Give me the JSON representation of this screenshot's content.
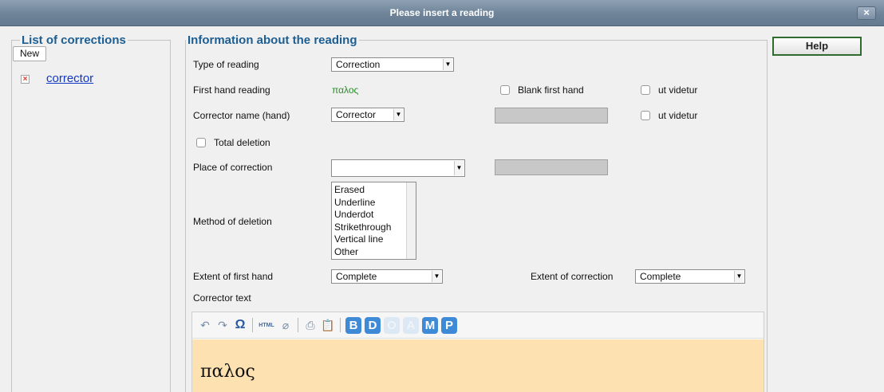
{
  "dialog": {
    "title": "Please insert a reading",
    "close_symbol": "×"
  },
  "corrections": {
    "legend": "List of corrections",
    "new_label": "New",
    "items": [
      {
        "label": "corrector",
        "delete_symbol": "×"
      }
    ]
  },
  "reading": {
    "legend": "Information about the reading",
    "type_label": "Type of reading",
    "type_value": "Correction",
    "first_hand_label": "First hand reading",
    "first_hand_value": "παλος",
    "blank_first_hand_label": "Blank first hand",
    "ut_videtur_label": "ut videtur",
    "corrector_name_label": "Corrector name (hand)",
    "corrector_name_value": "Corrector",
    "total_deletion_label": "Total deletion",
    "place_label": "Place of correction",
    "place_value": "",
    "method_label": "Method of deletion",
    "method_options": [
      "Erased",
      "Underline",
      "Underdot",
      "Strikethrough",
      "Vertical line",
      "Other"
    ],
    "extent_first_label": "Extent of first hand",
    "extent_first_value": "Complete",
    "extent_correction_label": "Extent of correction",
    "extent_correction_value": "Complete",
    "corrector_text_label": "Corrector text",
    "corrector_text_value": "παλος"
  },
  "help": {
    "label": "Help"
  },
  "editor_toolbar": {
    "undo_glyph": "↶",
    "redo_glyph": "↷",
    "omega_glyph": "Ω",
    "html_glyph": "HTML",
    "eraser_glyph": "⌀",
    "print_glyph": "⎙",
    "paste_glyph": "📋",
    "buttons": [
      "B",
      "D",
      "O",
      "A",
      "M",
      "P"
    ]
  },
  "colors": {
    "accent": "#1d5e92",
    "titlebar": "#6e8398",
    "editor_bg": "#fde1b1",
    "greek_green": "#2e8b2e",
    "toolbar_button": "#3f8ad7"
  }
}
